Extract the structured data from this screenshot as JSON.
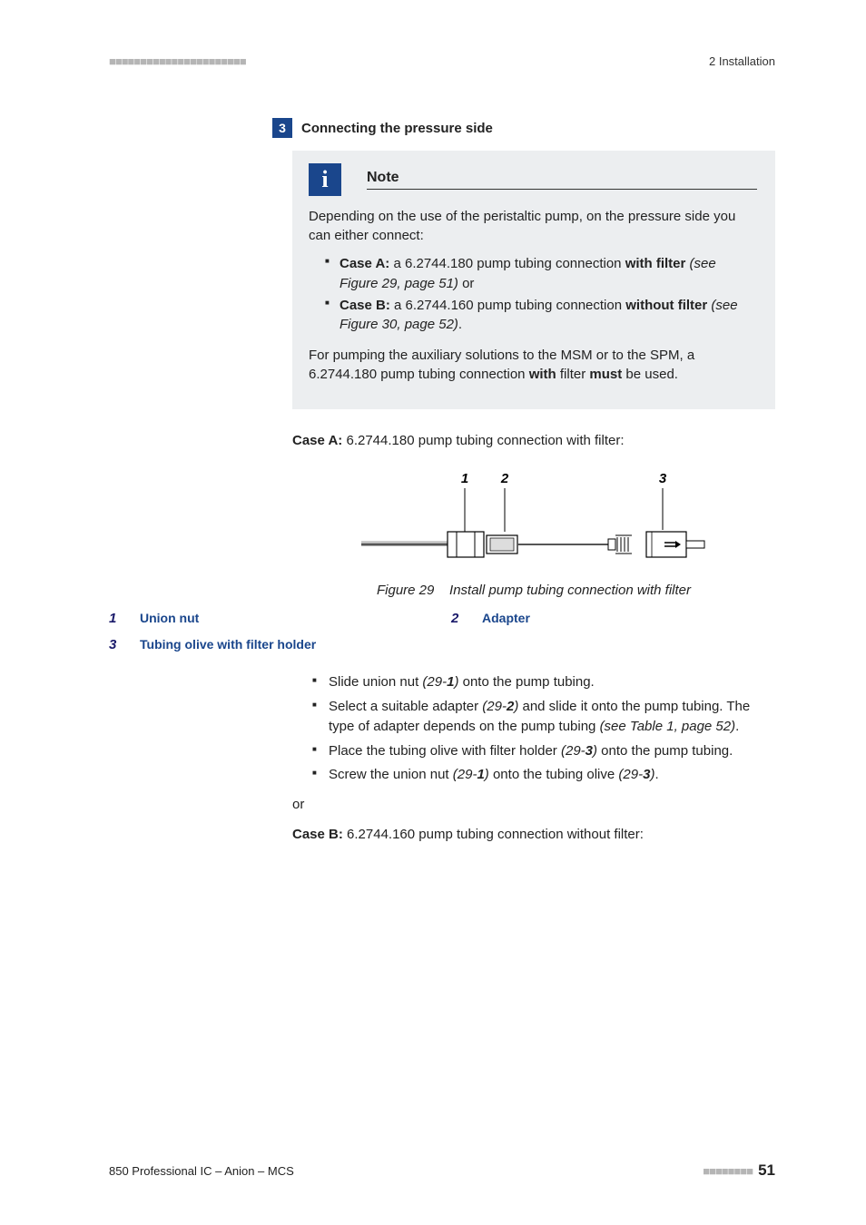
{
  "header": {
    "dashes_left": "■■■■■■■■■■■■■■■■■■■■■■",
    "right": "2 Installation"
  },
  "step": {
    "num": "3",
    "title": "Connecting the pressure side"
  },
  "note": {
    "title": "Note",
    "para1": "Depending on the use of the peristaltic pump, on the pressure side you can either connect:",
    "caseA_prefix": "Case A:",
    "caseA_text": " a 6.2744.180 pump tubing connection ",
    "caseA_bold": "with filter",
    "caseA_ref": " (see Figure 29, page 51)",
    "caseA_after": " or",
    "caseB_prefix": "Case B:",
    "caseB_text": " a 6.2744.160 pump tubing connection ",
    "caseB_bold": "without filter",
    "caseB_ref": " (see Figure 30, page 52)",
    "caseB_after": ".",
    "para2_a": "For pumping the auxiliary solutions to the MSM or to the SPM, a 6.2744.180 pump tubing connection ",
    "para2_b": "with",
    "para2_c": " filter ",
    "para2_d": "must",
    "para2_e": " be used."
  },
  "caseA_line_prefix": "Case A:",
  "caseA_line_text": " 6.2744.180 pump tubing connection with filter:",
  "figure": {
    "label1": "1",
    "label2": "2",
    "label3": "3",
    "caption_prefix": "Figure 29",
    "caption_text": "Install pump tubing connection with filter"
  },
  "legend": {
    "n1": "1",
    "l1": "Union nut",
    "n2": "2",
    "l2": "Adapter",
    "n3": "3",
    "l3": "Tubing olive with filter holder"
  },
  "instructions": {
    "i1_a": "Slide union nut ",
    "i1_ref": "(29-",
    "i1_num": "1",
    "i1_ref2": ")",
    "i1_b": " onto the pump tubing.",
    "i2_a": "Select a suitable adapter ",
    "i2_ref": "(29-",
    "i2_num": "2",
    "i2_ref2": ")",
    "i2_b": " and slide it onto the pump tubing. The type of adapter depends on the pump tubing ",
    "i2_c": "(see Table 1, page 52)",
    "i2_d": ".",
    "i3_a": "Place the tubing olive with filter holder ",
    "i3_ref": "(29-",
    "i3_num": "3",
    "i3_ref2": ")",
    "i3_b": " onto the pump tubing.",
    "i4_a": "Screw the union nut ",
    "i4_ref1": "(29-",
    "i4_num1": "1",
    "i4_ref1b": ")",
    "i4_b": " onto the tubing olive ",
    "i4_ref2": "(29-",
    "i4_num2": "3",
    "i4_ref2b": ")",
    "i4_c": "."
  },
  "or_text": "or",
  "caseB_line_prefix": "Case B:",
  "caseB_line_text": " 6.2744.160 pump tubing connection without filter:",
  "footer": {
    "left": "850 Professional IC – Anion – MCS",
    "dashes": "■■■■■■■■",
    "page": "51"
  }
}
